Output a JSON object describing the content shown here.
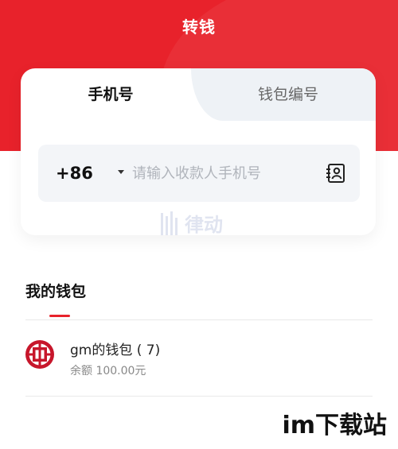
{
  "header": {
    "title": "转钱"
  },
  "tabs": [
    {
      "label": "手机号",
      "active": true
    },
    {
      "label": "钱包编号",
      "active": false
    }
  ],
  "phone": {
    "country_code": "+86",
    "placeholder": "请输入收款人手机号",
    "value": ""
  },
  "watermark_text": "律动",
  "wallet_section": {
    "title": "我的钱包",
    "items": [
      {
        "name": "gm的钱包 (        7)",
        "balance": "余额 100.00元",
        "icon": "icbc-bank-icon"
      }
    ]
  },
  "corner_brand": "im下载站",
  "colors": {
    "accent": "#e8222b",
    "tab_inactive_bg": "#eef2f6",
    "input_bg": "#f3f5f8"
  }
}
